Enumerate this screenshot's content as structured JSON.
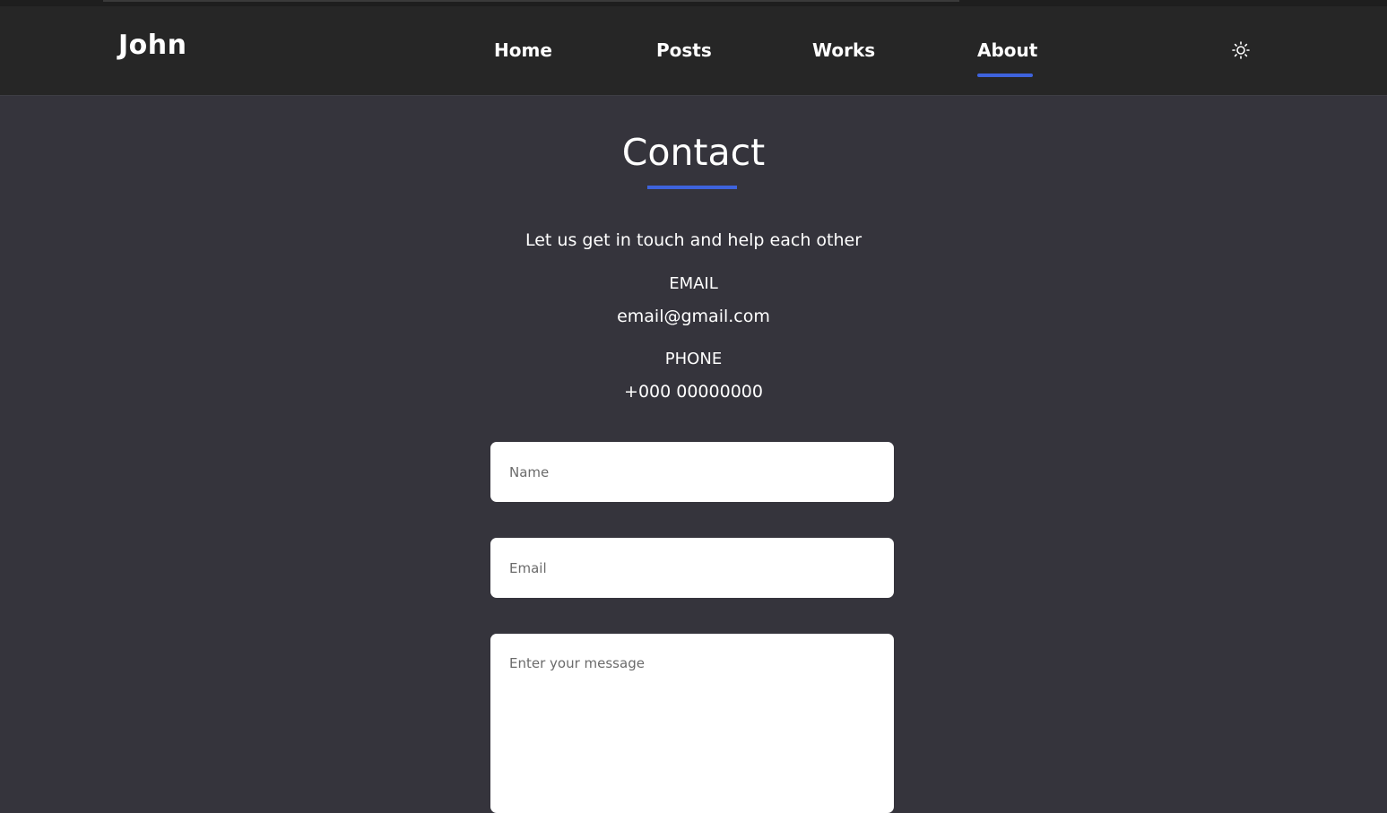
{
  "brand": "John",
  "nav": {
    "items": [
      {
        "label": "Home"
      },
      {
        "label": "Posts"
      },
      {
        "label": "Works"
      },
      {
        "label": "About"
      }
    ],
    "active": "About",
    "theme_icon": "sun-icon"
  },
  "contact": {
    "title": "Contact",
    "tagline": "Let us get in touch and help each other",
    "email_label": "EMAIL",
    "email_value": "email@gmail.com",
    "phone_label": "PHONE",
    "phone_value": "+000 00000000"
  },
  "form": {
    "name_placeholder": "Name",
    "email_placeholder": "Email",
    "message_placeholder": "Enter your message"
  },
  "colors": {
    "background": "#35343c",
    "navbar": "#262626",
    "accent": "#3e63dd",
    "text": "#ffffff"
  }
}
